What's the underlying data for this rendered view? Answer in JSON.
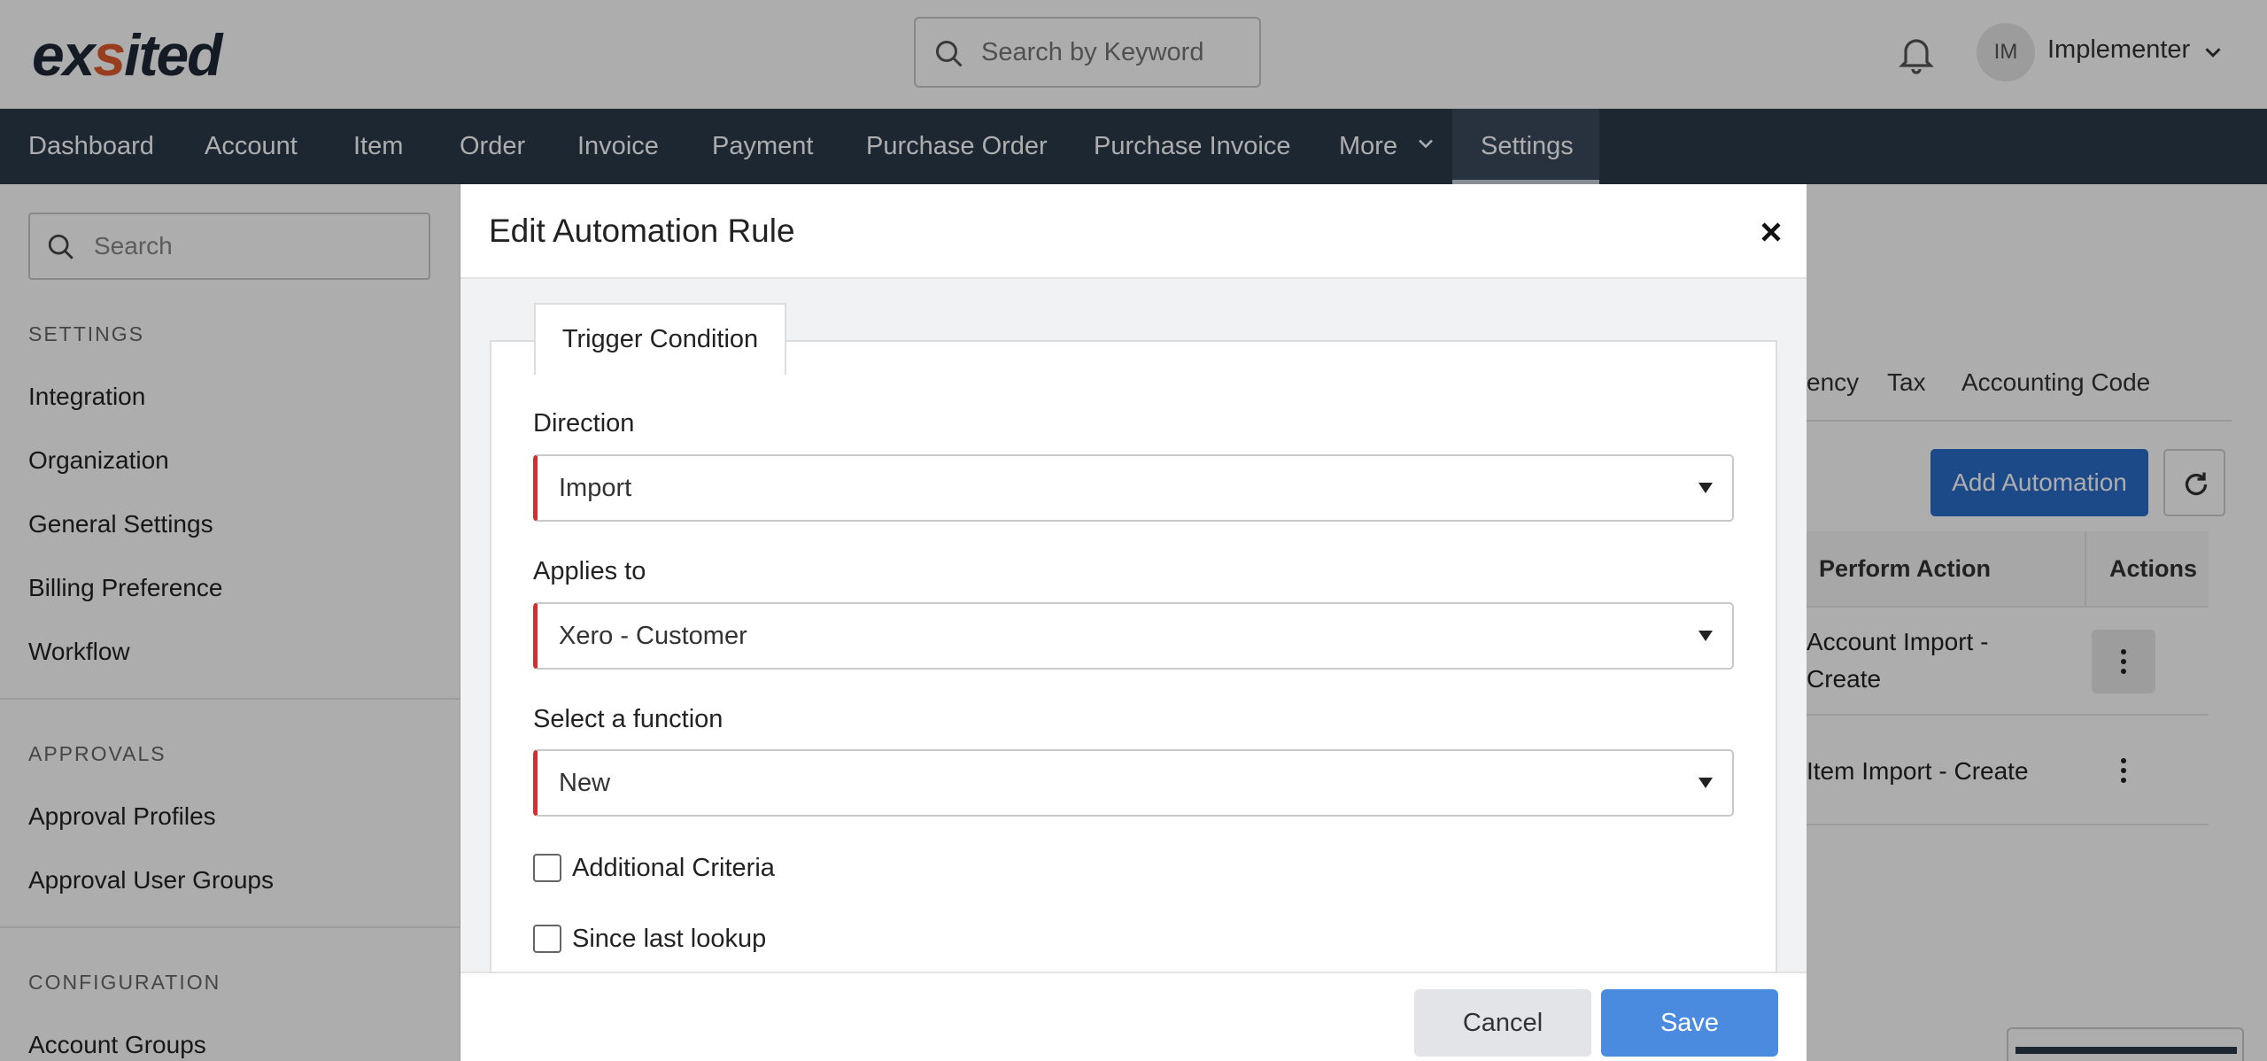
{
  "header": {
    "logo": "exsited",
    "search_placeholder": "Search by Keyword",
    "user_initials": "IM",
    "user_name": "Implementer"
  },
  "nav": {
    "items": [
      "Dashboard",
      "Account",
      "Item",
      "Order",
      "Invoice",
      "Payment",
      "Purchase Order",
      "Purchase Invoice",
      "More",
      "Settings"
    ],
    "active": "Settings"
  },
  "sidebar": {
    "search_placeholder": "Search",
    "settings_heading": "SETTINGS",
    "settings_items": [
      "Integration",
      "Organization",
      "General Settings",
      "Billing Preference",
      "Workflow"
    ],
    "approvals_heading": "APPROVALS",
    "approvals_items": [
      "Approval Profiles",
      "Approval User Groups"
    ],
    "configuration_heading": "CONFIGURATION",
    "configuration_items": [
      "Account Groups"
    ]
  },
  "main": {
    "tabs": [
      "ency",
      "Tax",
      "Accounting Code"
    ],
    "add_button": "Add Automation",
    "table": {
      "headers": [
        "Perform Action",
        "Actions"
      ],
      "rows": [
        {
          "action_line1": "Account Import -",
          "action_line2": "Create"
        },
        {
          "action_line1": "Item Import - Create",
          "action_line2": ""
        }
      ]
    }
  },
  "modal": {
    "title": "Edit Automation Rule",
    "tab": "Trigger Condition",
    "direction_label": "Direction",
    "direction_value": "Import",
    "applies_label": "Applies to",
    "applies_value": "Xero - Customer",
    "function_label": "Select a function",
    "function_value": "New",
    "checkbox1_label": "Additional Criteria",
    "checkbox2_label": "Since last lookup",
    "cancel_label": "Cancel",
    "save_label": "Save"
  },
  "colors": {
    "nav_bg": "#2b3a4a",
    "primary": "#2a6cc9",
    "save": "#4a8be0",
    "required": "#d32f2f"
  }
}
